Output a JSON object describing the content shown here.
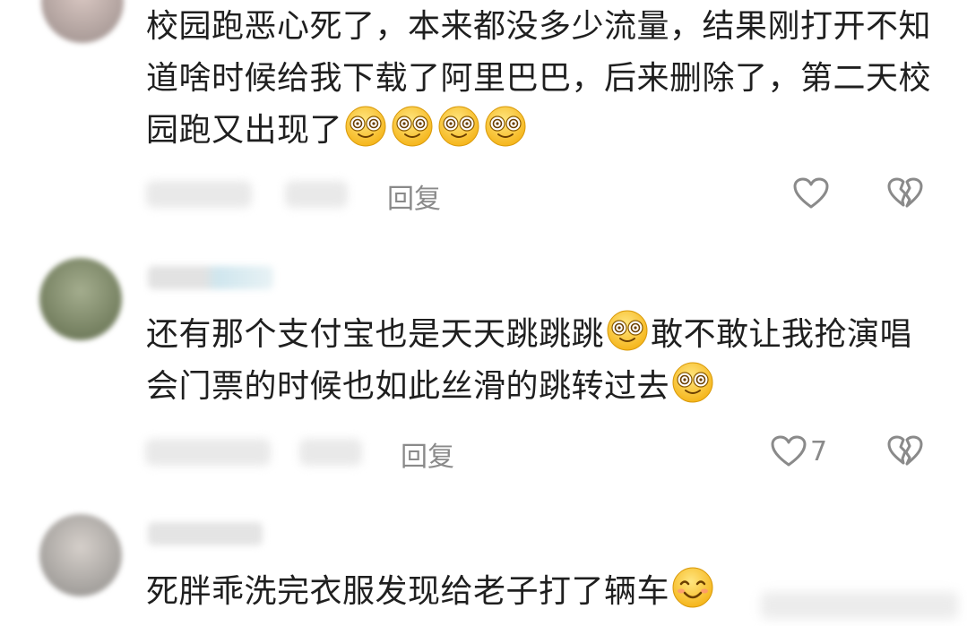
{
  "comments": [
    {
      "text": "校园跑恶心死了，本来都没多少流量，结果刚打开不知道啥时候给我下载了阿里巴巴，后来删除了，第二天校园跑又出现了",
      "emojis": [
        "dizzy-face-emoji",
        "dizzy-face-emoji",
        "dizzy-face-emoji",
        "dizzy-face-emoji"
      ],
      "reply_label": "回复",
      "like_count": ""
    },
    {
      "text_part1": "还有那个支付宝也是天天跳跳跳",
      "text_part2": "敢不敢让我抢演唱会门票的时候也如此丝滑的跳转过去",
      "emojis": [
        "dizzy-face-emoji",
        "dizzy-face-emoji"
      ],
      "reply_label": "回复",
      "like_count": "7"
    },
    {
      "text": "死胖乖洗完衣服发现给老子打了辆车",
      "emojis": [
        "smiling-face-emoji"
      ],
      "reply_label": "",
      "like_count": ""
    }
  ],
  "colors": {
    "text": "#1f1f1f",
    "meta": "#8a8a8a",
    "emoji": "#ffcc33"
  }
}
